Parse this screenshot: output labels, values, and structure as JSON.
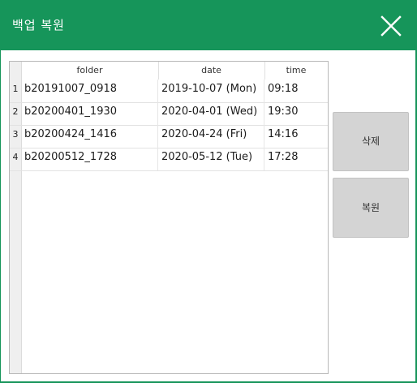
{
  "window": {
    "title": "백업 복원",
    "close_icon": "close-icon",
    "accent_color": "#16955a"
  },
  "table": {
    "columns": [
      "folder",
      "date",
      "time"
    ],
    "rows": [
      {
        "index": "1",
        "folder": "b20191007_0918",
        "date": "2019-10-07 (Mon)",
        "time": "09:18"
      },
      {
        "index": "2",
        "folder": "b20200401_1930",
        "date": "2020-04-01 (Wed)",
        "time": "19:30"
      },
      {
        "index": "3",
        "folder": "b20200424_1416",
        "date": "2020-04-24 (Fri)",
        "time": "14:16"
      },
      {
        "index": "4",
        "folder": "b20200512_1728",
        "date": "2020-05-12 (Tue)",
        "time": "17:28"
      }
    ]
  },
  "actions": {
    "delete_label": "삭제",
    "restore_label": "복원"
  }
}
